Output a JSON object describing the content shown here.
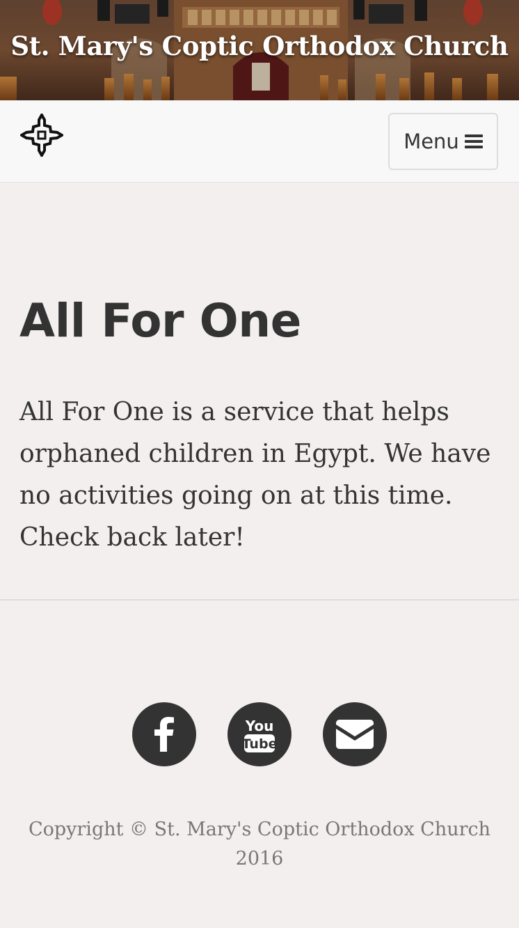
{
  "header": {
    "site_title": "St. Mary's Coptic Orthodox Church"
  },
  "navbar": {
    "logo_icon": "coptic-cross-icon",
    "menu_label": "Menu",
    "menu_icon": "bars-icon"
  },
  "main": {
    "heading": "All For One",
    "body": "All For One is a service that helps orphaned children in Egypt. We have no activities going on at this time. Check back later!"
  },
  "footer": {
    "social": [
      {
        "icon": "facebook-icon"
      },
      {
        "icon": "youtube-icon",
        "glyph_top": "You",
        "glyph_bottom": "Tube"
      },
      {
        "icon": "envelope-icon"
      }
    ],
    "copyright": "Copyright © St. Mary's Coptic Orthodox Church 2016"
  },
  "colors": {
    "page_background": "#f4efef",
    "navbar_background": "#f8f8f8",
    "text": "#333333",
    "muted_text": "#777777",
    "icon_circle": "#333333"
  }
}
